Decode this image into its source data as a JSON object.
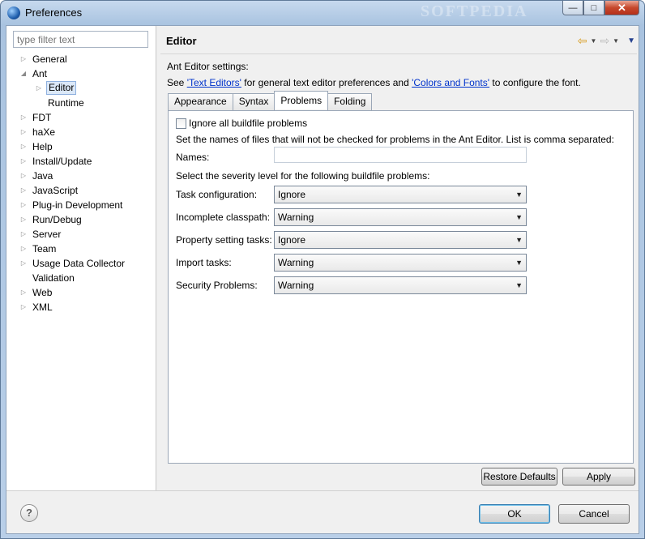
{
  "window": {
    "title": "Preferences",
    "watermark": "SOFTPEDIA"
  },
  "caption": {
    "minimize": "—",
    "maximize": "□",
    "close": "✕"
  },
  "filter": {
    "placeholder": "type filter text"
  },
  "tree": [
    {
      "label": "General",
      "twisty": "▷",
      "level": 0
    },
    {
      "label": "Ant",
      "twisty": "◢",
      "level": 0
    },
    {
      "label": "Editor",
      "twisty": "▷",
      "level": 1,
      "selected": true
    },
    {
      "label": "Runtime",
      "twisty": "",
      "level": 1
    },
    {
      "label": "FDT",
      "twisty": "▷",
      "level": 0
    },
    {
      "label": "haXe",
      "twisty": "▷",
      "level": 0
    },
    {
      "label": "Help",
      "twisty": "▷",
      "level": 0
    },
    {
      "label": "Install/Update",
      "twisty": "▷",
      "level": 0
    },
    {
      "label": "Java",
      "twisty": "▷",
      "level": 0
    },
    {
      "label": "JavaScript",
      "twisty": "▷",
      "level": 0
    },
    {
      "label": "Plug-in Development",
      "twisty": "▷",
      "level": 0
    },
    {
      "label": "Run/Debug",
      "twisty": "▷",
      "level": 0
    },
    {
      "label": "Server",
      "twisty": "▷",
      "level": 0
    },
    {
      "label": "Team",
      "twisty": "▷",
      "level": 0
    },
    {
      "label": "Usage Data Collector",
      "twisty": "▷",
      "level": 0
    },
    {
      "label": "Validation",
      "twisty": "",
      "level": 0
    },
    {
      "label": "Web",
      "twisty": "▷",
      "level": 0
    },
    {
      "label": "XML",
      "twisty": "▷",
      "level": 0
    }
  ],
  "page": {
    "title": "Editor",
    "settings_header": "Ant Editor settings:",
    "see_prefix": "See ",
    "link_text_editors": "'Text Editors'",
    "see_middle": " for general text editor preferences and ",
    "link_colors_fonts": "'Colors and Fonts'",
    "see_suffix": " to configure the font."
  },
  "nav": {
    "back": "⇦",
    "forward": "⇨",
    "dropdown": "▼",
    "menu": "▼"
  },
  "tabs": [
    {
      "label": "Appearance",
      "active": false
    },
    {
      "label": "Syntax",
      "active": false
    },
    {
      "label": "Problems",
      "active": true
    },
    {
      "label": "Folding",
      "active": false
    }
  ],
  "problems": {
    "ignore_all_label": "Ignore all buildfile problems",
    "ignore_all_checked": false,
    "names_description": "Set the names of files that will not be checked for problems in the Ant Editor. List is comma separated:",
    "names_label": "Names:",
    "names_value": "",
    "severity_description": "Select the severity level for the following buildfile problems:",
    "severities": [
      {
        "label": "Task configuration:",
        "value": "Ignore"
      },
      {
        "label": "Incomplete classpath:",
        "value": "Warning"
      },
      {
        "label": "Property setting tasks:",
        "value": "Ignore"
      },
      {
        "label": "Import tasks:",
        "value": "Warning"
      },
      {
        "label": "Security Problems:",
        "value": "Warning"
      }
    ]
  },
  "buttons": {
    "restore_defaults": "Restore Defaults",
    "apply": "Apply",
    "ok": "OK",
    "cancel": "Cancel",
    "help": "?"
  }
}
